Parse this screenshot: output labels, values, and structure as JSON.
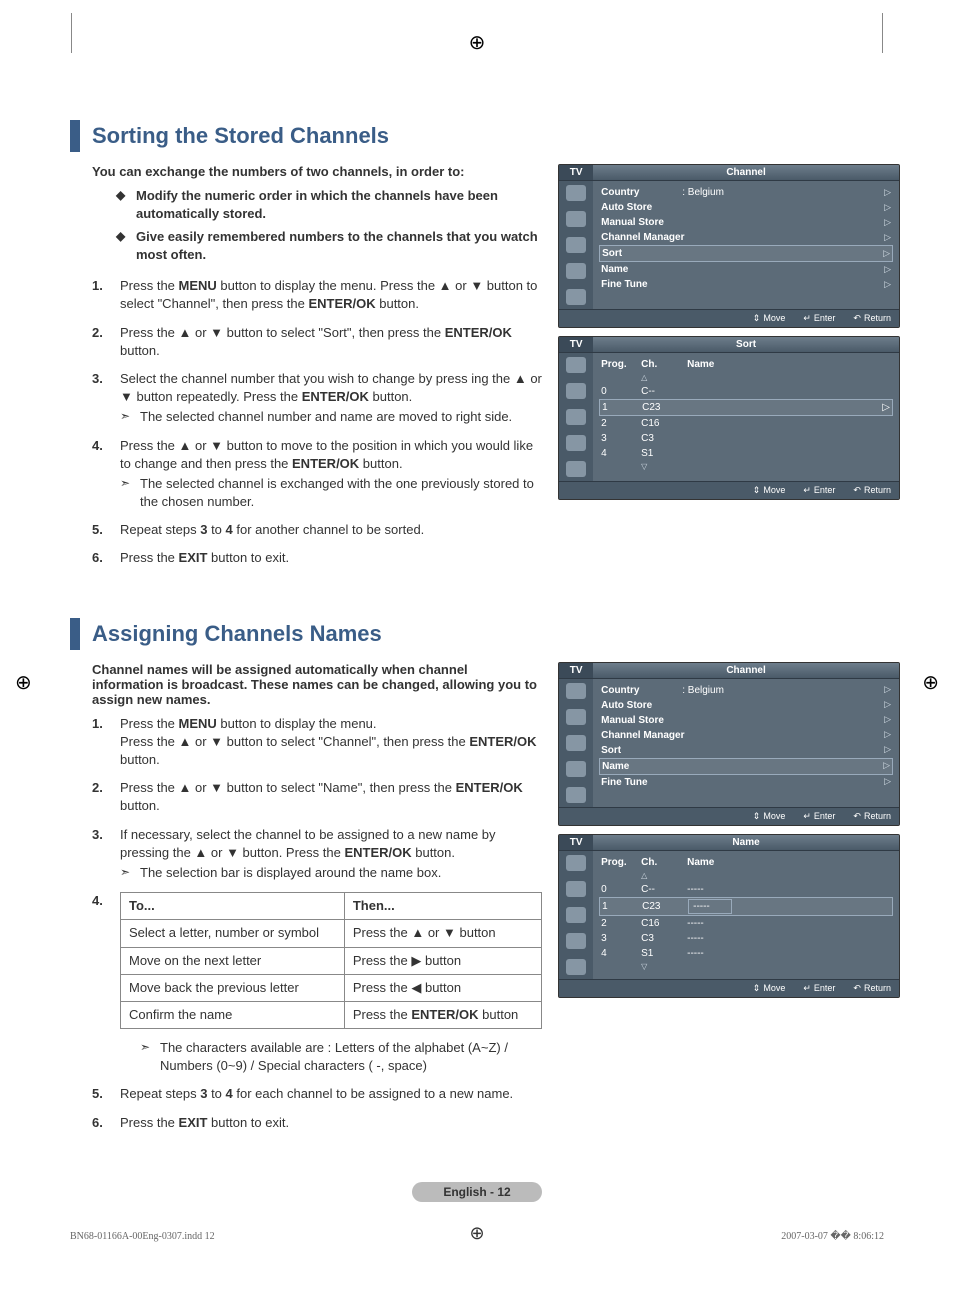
{
  "section1": {
    "title": "Sorting the Stored Channels",
    "intro": "You can exchange the numbers of two channels, in order to:",
    "bullets": [
      "Modify the numeric order in which the channels have been automatically stored.",
      "Give easily remembered numbers to the channels that you watch most often."
    ],
    "steps": [
      {
        "num": "1.",
        "html": "Press the <b>MENU</b> button to display the menu.  Press the ▲ or ▼ button to select \"Channel\", then press the <b>ENTER/OK</b> button."
      },
      {
        "num": "2.",
        "html": "Press the ▲ or ▼ button to select \"Sort\", then press the <b>ENTER/OK</b> button."
      },
      {
        "num": "3.",
        "html": "Select the channel number that you wish to change by press ing the ▲ or ▼ button repeatedly. Press the <b>ENTER/OK</b> button.",
        "sub": "The selected channel number and name are moved to right side."
      },
      {
        "num": "4.",
        "html": "Press the ▲ or ▼ button to move to the position in which you would like to change and then press the  <b>ENTER/OK</b> button.",
        "sub": "The selected channel is exchanged with the one previously stored to the chosen number."
      },
      {
        "num": "5.",
        "html": "Repeat steps <b>3</b> to <b>4</b> for another channel to be sorted."
      },
      {
        "num": "6.",
        "html": "Press the <b>EXIT</b> button to exit."
      }
    ]
  },
  "section2": {
    "title": "Assigning Channels Names",
    "intro": "Channel names will be assigned automatically when channel information is broadcast. These names can be changed, allowing you to assign new names.",
    "steps": [
      {
        "num": "1.",
        "html": "Press the <b>MENU</b> button to display the menu.<br>Press the ▲ or ▼ button to select \"Channel\", then press the <b>ENTER/OK</b> button."
      },
      {
        "num": "2.",
        "html": "Press the ▲ or ▼ button to select \"Name\", then press the <b>ENTER/OK</b> button."
      },
      {
        "num": "3.",
        "html": "If necessary, select the channel to be assigned to a new name by pressing the ▲ or ▼ button. Press the <b>ENTER/OK</b> button.",
        "sub": "The selection bar is displayed around the name box."
      }
    ],
    "step4num": "4.",
    "table": {
      "head": [
        "To...",
        "Then..."
      ],
      "rows": [
        [
          "Select a letter, number or symbol",
          "Press the ▲ or ▼ button"
        ],
        [
          "Move on the next letter",
          "Press the ▶ button"
        ],
        [
          "Move back the previous letter",
          "Press the ◀ button"
        ],
        [
          "Confirm the name",
          "Press the <b>ENTER/OK</b> button"
        ]
      ]
    },
    "note_after_table": "The characters available are : Letters of the alphabet (A~Z) / Numbers (0~9) / Special characters ( -, space)",
    "steps_cont": [
      {
        "num": "5.",
        "html": "Repeat steps <b>3</b> to <b>4</b> for each channel to be assigned to a new name."
      },
      {
        "num": "6.",
        "html": "Press the <b>EXIT</b> button to exit."
      }
    ]
  },
  "osd_strings": {
    "tv": "TV",
    "channel": "Channel",
    "sort": "Sort",
    "name": "Name",
    "country": "Country",
    "country_val": ": Belgium",
    "auto_store": "Auto Store",
    "manual_store": "Manual Store",
    "channel_manager": "Channel Manager",
    "fine_tune": "Fine Tune",
    "prog": "Prog.",
    "ch": "Ch.",
    "name_col": "Name",
    "move": "Move",
    "enter": "Enter",
    "return": "Return"
  },
  "osd_sort_rows": [
    {
      "prog": "0",
      "ch": "C--",
      "name": ""
    },
    {
      "prog": "1",
      "ch": "C23",
      "name": "",
      "selected": true
    },
    {
      "prog": "2",
      "ch": "C16",
      "name": ""
    },
    {
      "prog": "3",
      "ch": "C3",
      "name": ""
    },
    {
      "prog": "4",
      "ch": "S1",
      "name": ""
    }
  ],
  "osd_name_rows": [
    {
      "prog": "0",
      "ch": "C--",
      "name": "-----"
    },
    {
      "prog": "1",
      "ch": "C23",
      "name": "-----",
      "selected": true
    },
    {
      "prog": "2",
      "ch": "C16",
      "name": "-----"
    },
    {
      "prog": "3",
      "ch": "C3",
      "name": "-----"
    },
    {
      "prog": "4",
      "ch": "S1",
      "name": "-----"
    }
  ],
  "page_label": "English - 12",
  "doc_footer_left": "BN68-01166A-00Eng-0307.indd   12",
  "doc_footer_right": "2007-03-07   �� 8:06:12"
}
